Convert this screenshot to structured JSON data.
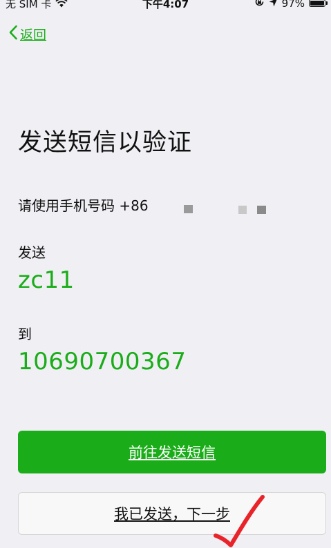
{
  "status_bar": {
    "carrier": "无 SIM 卡",
    "time": "下午4:07",
    "battery": "97%"
  },
  "nav": {
    "back_label": "返回"
  },
  "page": {
    "title": "发送短信以验证",
    "phone_prefix": "请使用手机号码 +86",
    "send_label": "发送",
    "send_content": "zc11",
    "to_label": "到",
    "to_number": "10690700367"
  },
  "actions": {
    "primary_label": "前往发送短信",
    "secondary_label": "我已发送，下一步"
  },
  "colors": {
    "accent": "#1aad19",
    "background": "#efeff4",
    "annotation": "#e8242a"
  },
  "icons": {
    "wifi": "wifi-icon",
    "back": "chevron-left-icon",
    "rotation_lock": "rotation-lock-icon",
    "location": "location-arrow-icon",
    "battery": "battery-icon",
    "check": "check-mark-icon"
  }
}
